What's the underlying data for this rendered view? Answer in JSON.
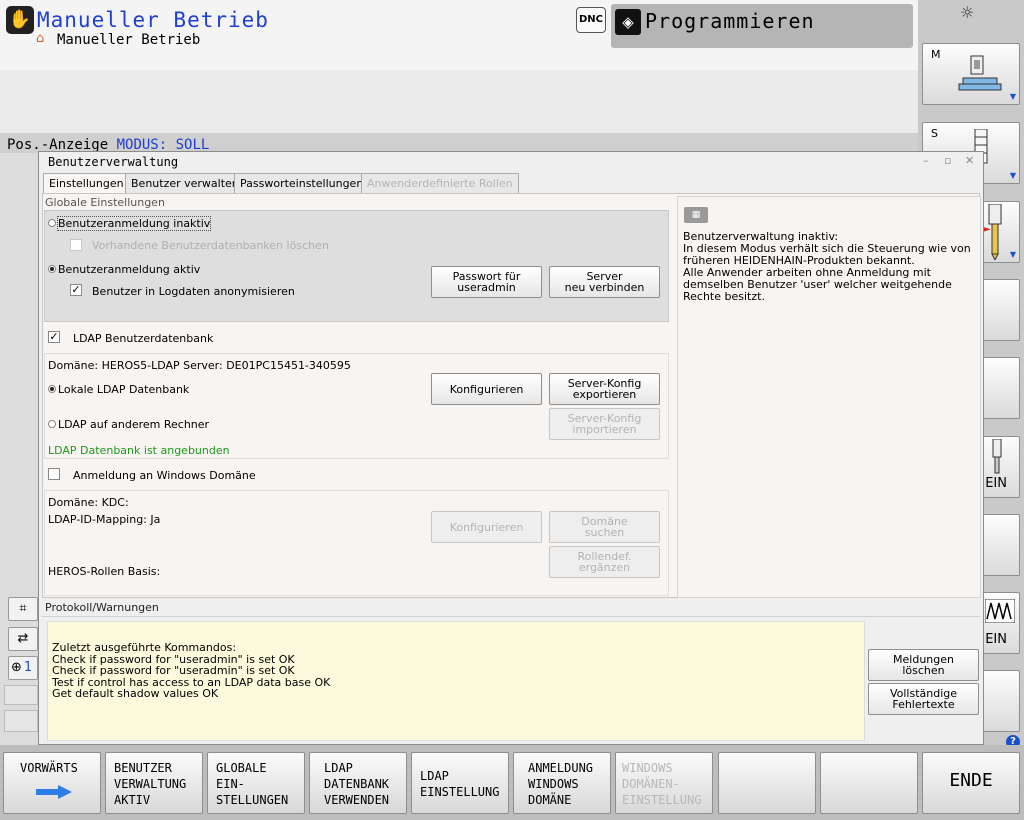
{
  "mode": {
    "title": "Manueller Betrieb",
    "subtitle": "Manueller Betrieb"
  },
  "header": {
    "dnc_label": "DNC",
    "programming_title": "Programmieren"
  },
  "pos_display": {
    "label": "Pos.-Anzeige",
    "mode": "MODUS: SOLL"
  },
  "right_softkeys": [
    {
      "label": "M"
    },
    {
      "label": "S"
    },
    {
      "label": ""
    },
    {
      "label": ""
    },
    {
      "label": ""
    },
    {
      "label": "",
      "status": "EIN"
    },
    {
      "label": ""
    },
    {
      "label": "",
      "status": "EIN"
    },
    {
      "label": ""
    }
  ],
  "left_strip": {
    "counter": "1"
  },
  "dialog": {
    "title": "Benutzerverwaltung",
    "tabs": [
      {
        "label": "Einstellungen"
      },
      {
        "label": "Benutzer verwalten"
      },
      {
        "label": "Passworteinstellungen"
      },
      {
        "label": "Anwenderdefinierte Rollen"
      }
    ],
    "global": {
      "heading": "Globale Einstellungen",
      "login_inactive": "Benutzeranmeldung inaktiv",
      "delete_dbs": "Vorhandene Benutzerdatenbanken löschen",
      "login_active": "Benutzeranmeldung aktiv",
      "anonymize": "Benutzer in Logdaten anonymisieren",
      "btn_password": "Passwort für\nuseradmin",
      "btn_reconnect": "Server\nneu verbinden"
    },
    "ldap": {
      "checkbox": "LDAP Benutzerdatenbank",
      "domain_info": "Domäne: HEROS5-LDAP Server: DE01PC15451-340595",
      "local": "Lokale LDAP Datenbank",
      "remote": "LDAP auf anderem Rechner",
      "status": "LDAP Datenbank ist angebunden",
      "btn_configure": "Konfigurieren",
      "btn_export": "Server-Konfig\nexportieren",
      "btn_import": "Server-Konfig\nimportieren"
    },
    "windows": {
      "checkbox": "Anmeldung an Windows Domäne",
      "domain": "Domäne:  KDC:",
      "mapping": "LDAP-ID-Mapping: Ja",
      "roles": "HEROS-Rollen Basis:",
      "btn_configure": "Konfigurieren",
      "btn_search": "Domäne\nsuchen",
      "btn_roles": "Rollendef.\nergänzen"
    },
    "info": "Benutzerverwaltung inaktiv:\nIn diesem Modus verhält sich die Steuerung wie von früheren HEIDENHAIN-Produkten bekannt.\nAlle Anwender arbeiten ohne Anmeldung mit demselben Benutzer 'user' welcher weitgehende Rechte besitzt.",
    "log": {
      "heading": "Protokoll/Warnungen",
      "text": "Zuletzt ausgeführte Kommandos:\nCheck if password for \"useradmin\" is set OK\nCheck if password for \"useradmin\" is set OK\nTest if control has access to an LDAP data base OK\nGet default shadow values OK",
      "btn_clear": "Meldungen\nlöschen",
      "btn_full": "Vollständige\nFehlertexte"
    }
  },
  "softkeys": [
    {
      "label": "VORWÄRTS",
      "enabled": true
    },
    {
      "label": "BENUTZER\nVERWALTUNG\nAKTIV",
      "enabled": true
    },
    {
      "label": "GLOBALE\nEIN-\nSTELLUNGEN",
      "enabled": true
    },
    {
      "label": "LDAP\nDATENBANK\nVERWENDEN",
      "enabled": true
    },
    {
      "label": "LDAP\nEINSTELLUNG",
      "enabled": true
    },
    {
      "label": "ANMELDUNG\nWINDOWS\nDOMÄNE",
      "enabled": true
    },
    {
      "label": "WINDOWS\nDOMÄNEN-\nEINSTELLUNG",
      "enabled": false
    },
    {
      "label": "",
      "enabled": true
    },
    {
      "label": "",
      "enabled": true
    },
    {
      "label": "ENDE",
      "enabled": true
    }
  ],
  "colors": {
    "accent_blue": "#1f3fd0",
    "status_green": "#1b9a1b",
    "log_bg": "#fbfadc"
  }
}
